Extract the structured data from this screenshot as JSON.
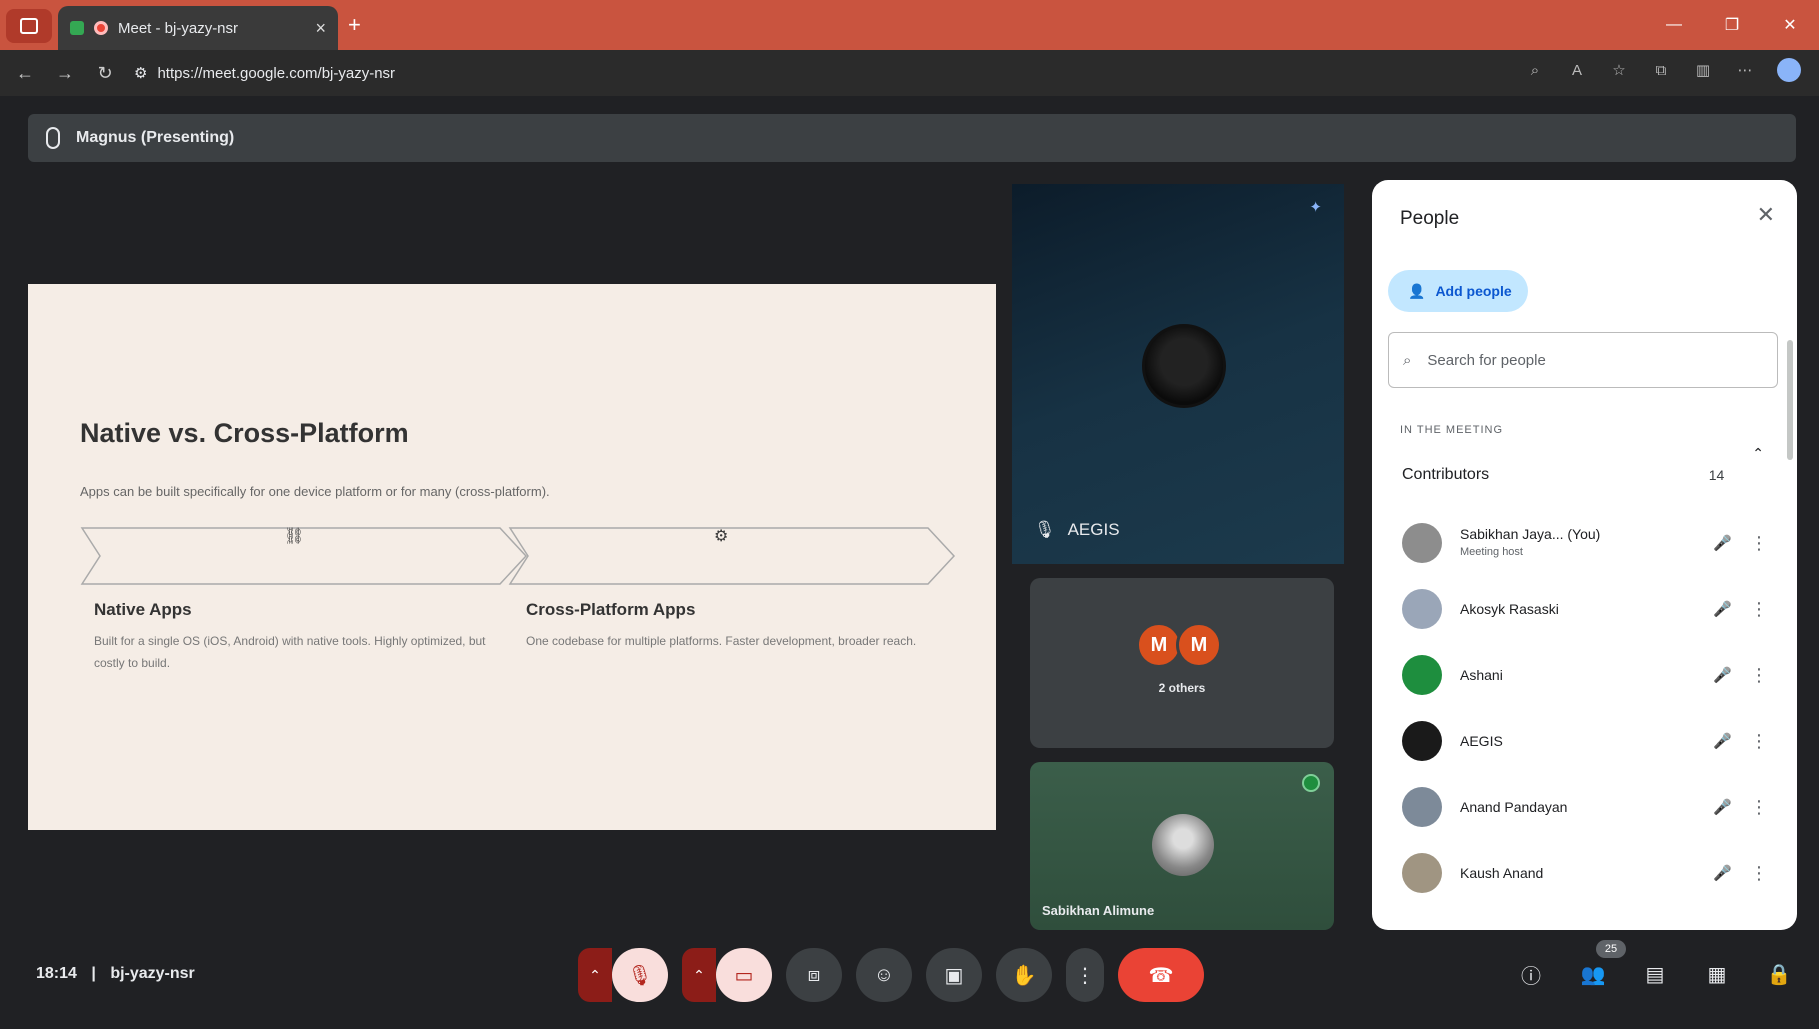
{
  "browser": {
    "tab_title": "Meet - bj-yazy-nsr",
    "url": "https://meet.google.com/bj-yazy-nsr",
    "new_tab_glyph": "+",
    "tab_close_glyph": "×",
    "window_controls": [
      "—",
      "❐",
      "✕"
    ]
  },
  "meeting": {
    "presenting_label": "Magnus (Presenting)",
    "time": "18:14",
    "separator": "|",
    "code": "bj-yazy-nsr"
  },
  "slide": {
    "title": "Native vs. Cross-Platform",
    "subtitle": "Apps can be built specifically for one device platform or for many (cross-platform).",
    "native_icon": "⛓",
    "cross_icon": "⚙",
    "native_title": "Native Apps",
    "native_desc": "Built for a single OS (iOS, Android) with native tools. Highly optimized, but costly to build.",
    "cross_title": "Cross-Platform Apps",
    "cross_desc": "One codebase for multiple platforms. Faster development, broader reach."
  },
  "tiles": {
    "top_name": "AEGIS",
    "mid_initials": [
      "M",
      "M"
    ],
    "mid_label": "2 others",
    "bot_label": "Sabikhan Alimune"
  },
  "people": {
    "header": "People",
    "add_label": "Add people",
    "search_placeholder": "Search for people",
    "section_label": "IN THE MEETING",
    "group_label": "Contributors",
    "group_count": "14",
    "list": [
      {
        "name": "Sabikhan Jaya... (You)",
        "sub": "Meeting host",
        "color": "#8d8d8d"
      },
      {
        "name": "Akosyk Rasaski",
        "sub": "",
        "color": "#9aa6b8"
      },
      {
        "name": "Ashani",
        "sub": "",
        "color": "#1e8e3e"
      },
      {
        "name": "AEGIS",
        "sub": "",
        "color": "#1a1a1a"
      },
      {
        "name": "Anand Pandayan",
        "sub": "",
        "color": "#7d8a99"
      },
      {
        "name": "Kaush Anand",
        "sub": "",
        "color": "#a09582"
      }
    ]
  },
  "controls": {
    "people_count": "25"
  },
  "colors": {
    "accent": "#c2e7ff",
    "end_call": "#ea4335",
    "tab_strip": "#c9543f"
  }
}
